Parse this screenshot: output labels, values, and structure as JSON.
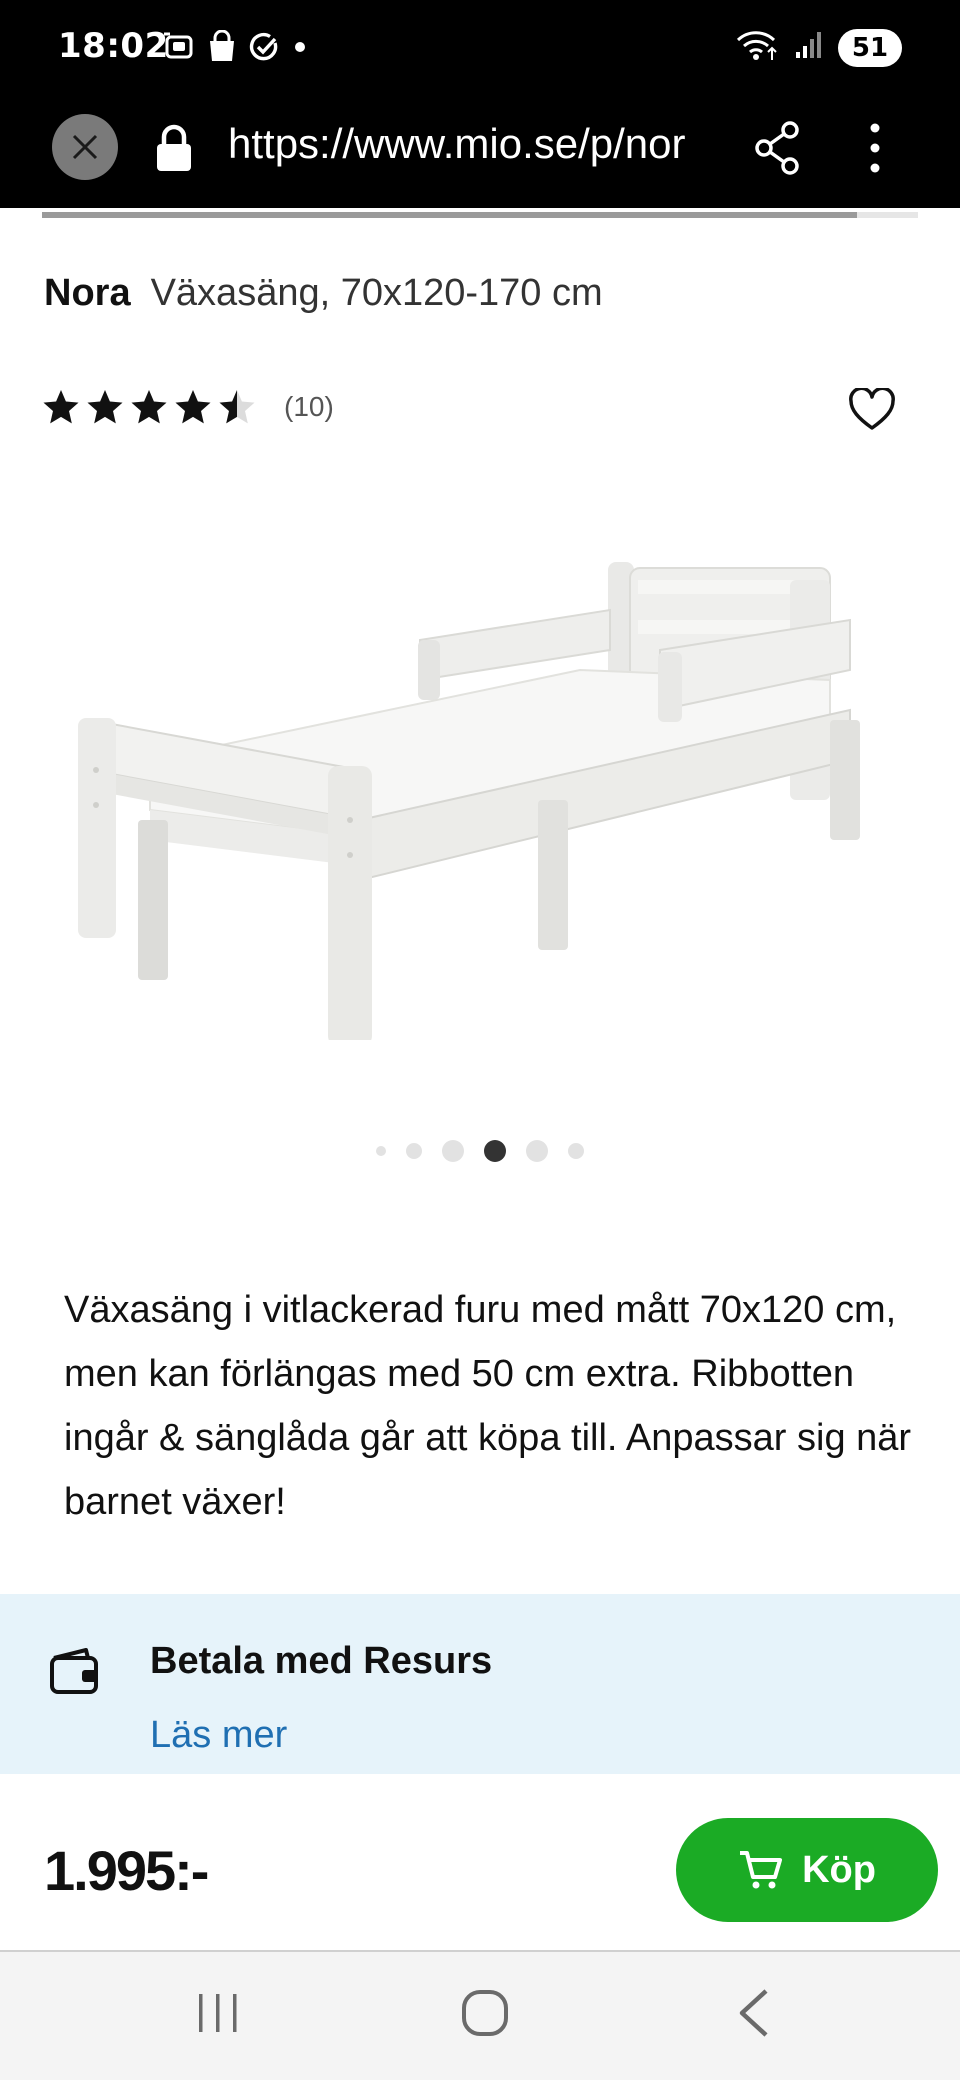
{
  "status_bar": {
    "time": "18:02",
    "icons": [
      "screenshot-icon",
      "shopping-bag-icon",
      "check-circle-icon",
      "dot-icon"
    ],
    "right_icons": [
      "wifi-icon",
      "signal-icon"
    ],
    "battery": "51"
  },
  "browser": {
    "url": "https://www.mio.se/p/nor",
    "close_icon": "close-icon",
    "lock_icon": "lock-icon",
    "share_icon": "share-icon",
    "menu_icon": "more-vert-icon",
    "page_load_progress": 0.93
  },
  "product": {
    "brand": "Nora",
    "name": "Växasäng, 70x120-170 cm",
    "rating": 4.5,
    "rating_max": 5,
    "review_count": "(10)",
    "favorite_icon": "heart-icon",
    "image_alt_icon": "bed-image",
    "carousel": {
      "count": 6,
      "active_index": 3
    },
    "description": "Växasäng i vitlackerad furu med mått 70x120 cm, men kan förlängas med 50 cm extra. Ribbotten ingår & sänglåda går att köpa till. Anpassar sig när barnet växer!"
  },
  "payment": {
    "icon": "wallet-icon",
    "title": "Betala med Resurs",
    "link": "Läs mer"
  },
  "buy_bar": {
    "price": "1.995:-",
    "button_label": "Köp",
    "button_icon": "cart-icon"
  },
  "colors": {
    "buy_green": "#1bab25",
    "link_blue": "#1f6fb2",
    "banner_bg": "#e6f3fa"
  },
  "nav_bar": [
    "recents-icon",
    "home-icon",
    "back-icon"
  ]
}
